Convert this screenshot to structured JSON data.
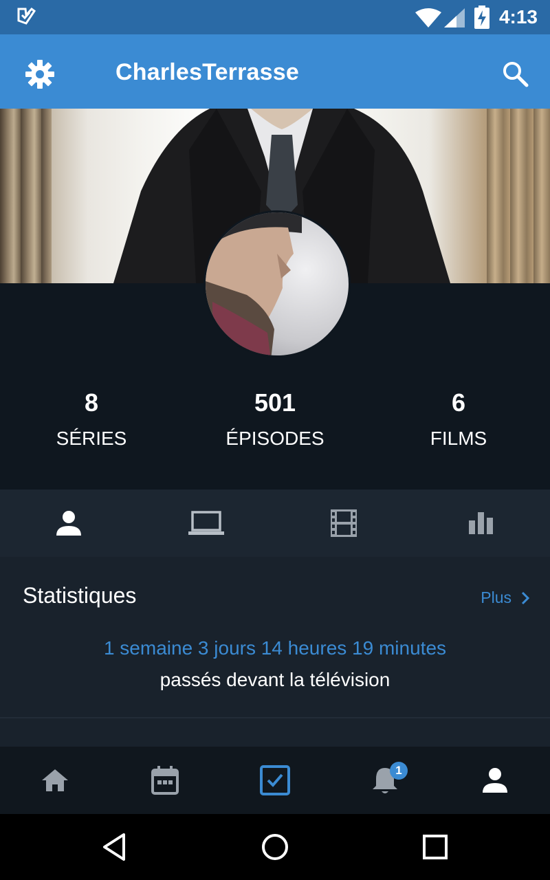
{
  "status_bar": {
    "time": "4:13",
    "icons": [
      "app-notification-icon",
      "wifi-icon",
      "cell-signal-icon",
      "battery-charging-icon"
    ]
  },
  "app_bar": {
    "title": "CharlesTerrasse",
    "left_icon": "gear-icon",
    "right_icon": "search-icon",
    "color": "#3b8bd3"
  },
  "profile": {
    "stats": [
      {
        "value": "8",
        "label": "SÉRIES"
      },
      {
        "value": "501",
        "label": "ÉPISODES"
      },
      {
        "value": "6",
        "label": "FILMS"
      }
    ]
  },
  "tabs": [
    {
      "icon": "person-icon",
      "active": true
    },
    {
      "icon": "laptop-icon",
      "active": false
    },
    {
      "icon": "film-strip-icon",
      "active": false
    },
    {
      "icon": "bar-chart-icon",
      "active": false
    }
  ],
  "statistics": {
    "title": "Statistiques",
    "more_label": "Plus",
    "time_watched": "1 semaine 3 jours 14 heures 19 minutes",
    "caption": "passés devant la télévision"
  },
  "bottom_nav": {
    "items": [
      {
        "icon": "home-icon",
        "active": false
      },
      {
        "icon": "calendar-icon",
        "active": false
      },
      {
        "icon": "checkbox-icon",
        "active": true
      },
      {
        "icon": "bell-icon",
        "active": false,
        "badge": "1"
      },
      {
        "icon": "person-icon",
        "active": true
      }
    ]
  },
  "colors": {
    "accent": "#3b8bd3",
    "background": "#0f171f",
    "tab_bar": "#1c2631",
    "content": "#19222c"
  }
}
